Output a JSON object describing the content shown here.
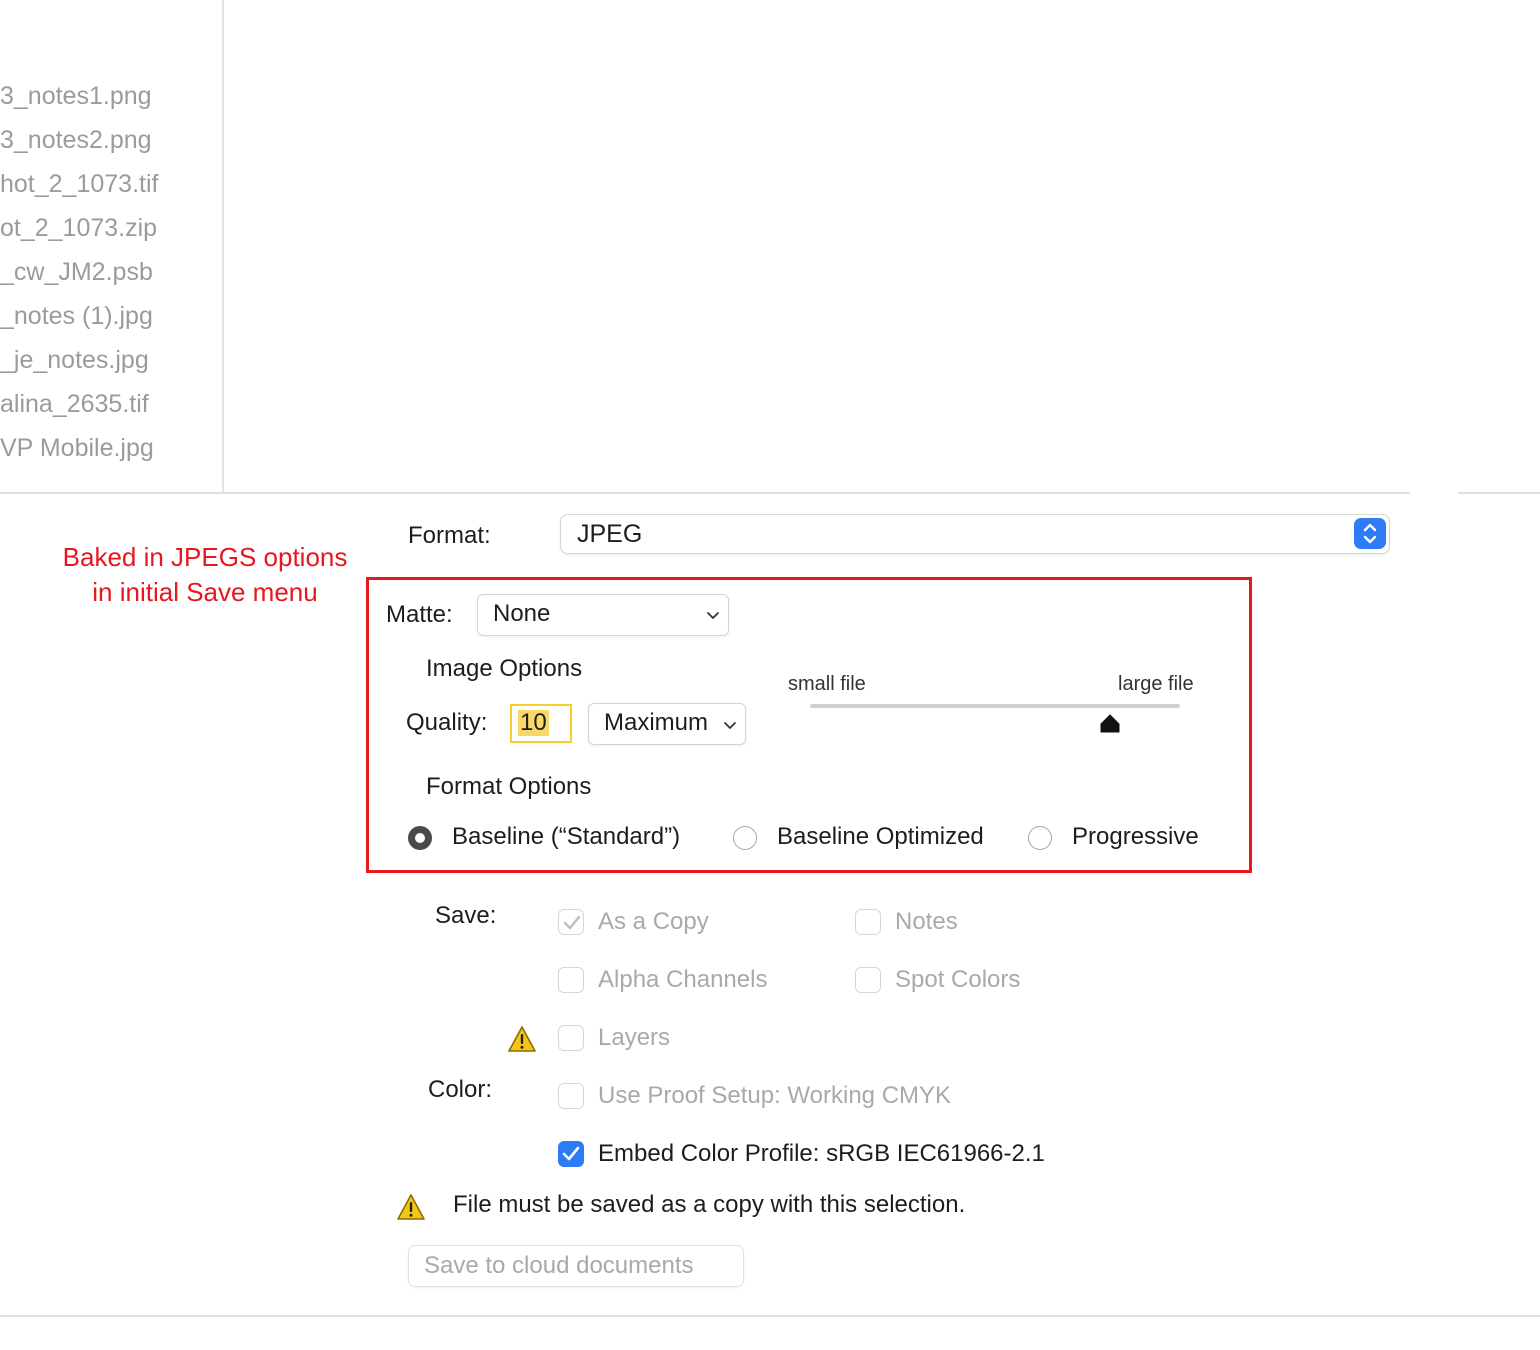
{
  "file_list": [
    "3_notes1.png",
    "3_notes2.png",
    "hot_2_1073.tif",
    "ot_2_1073.zip",
    "_cw_JM2.psb",
    "_notes (1).jpg",
    "_je_notes.jpg",
    "alina_2635.tif",
    "VP Mobile.jpg"
  ],
  "format": {
    "label": "Format:",
    "value": "JPEG"
  },
  "annotation": {
    "line1": "Baked in JPEGS options",
    "line2": "in initial Save menu"
  },
  "matte": {
    "label": "Matte:",
    "value": "None"
  },
  "image_options": {
    "heading": "Image Options",
    "quality_label": "Quality:",
    "quality_value": "10",
    "quality_preset": "Maximum",
    "small_file": "small file",
    "large_file": "large file",
    "slider_fraction": 0.81
  },
  "format_options": {
    "heading": "Format Options",
    "options": [
      "Baseline (“Standard”)",
      "Baseline Optimized",
      "Progressive"
    ],
    "selected": 0
  },
  "save": {
    "label": "Save:",
    "as_a_copy": "As a Copy",
    "notes": "Notes",
    "alpha_channels": "Alpha Channels",
    "spot_colors": "Spot Colors",
    "layers": "Layers"
  },
  "color": {
    "label": "Color:",
    "use_proof_setup": "Use Proof Setup:  Working CMYK",
    "embed_color_profile": "Embed Color Profile:  sRGB IEC61966-2.1"
  },
  "warning": "File must be saved as a copy with this selection.",
  "cloud_button": "Save to cloud documents",
  "colors": {
    "annotation_red": "#e5171f",
    "accent_blue": "#2d7cf6",
    "highlight_yellow": "#f9d86a"
  }
}
